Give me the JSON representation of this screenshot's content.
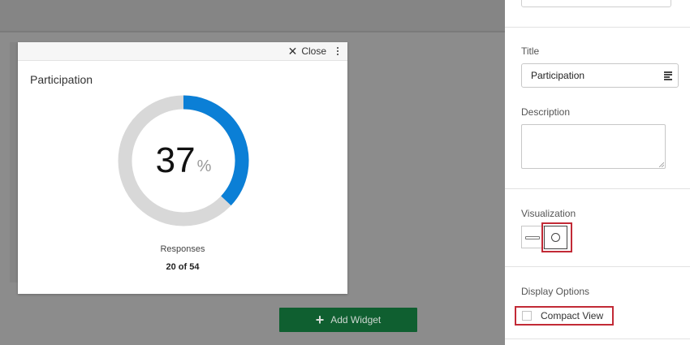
{
  "widget": {
    "close_label": "Close",
    "title": "Participation",
    "value": "37",
    "unit": "%",
    "progress_fraction": 0.37,
    "responses_label": "Responses",
    "responses_count": "20 of 54",
    "track_color": "#d8d8d8",
    "fill_color": "#0b7fd6"
  },
  "actions": {
    "add_widget_label": "Add Widget"
  },
  "panel": {
    "title_label": "Title",
    "title_value": "Participation",
    "description_label": "Description",
    "description_value": "",
    "visualization_label": "Visualization",
    "visualization_selected": "circle",
    "display_options_label": "Display Options",
    "compact_view_label": "Compact View",
    "compact_view_checked": false
  },
  "colors": {
    "highlight": "#c22a36",
    "button_green": "#0f5f30"
  }
}
